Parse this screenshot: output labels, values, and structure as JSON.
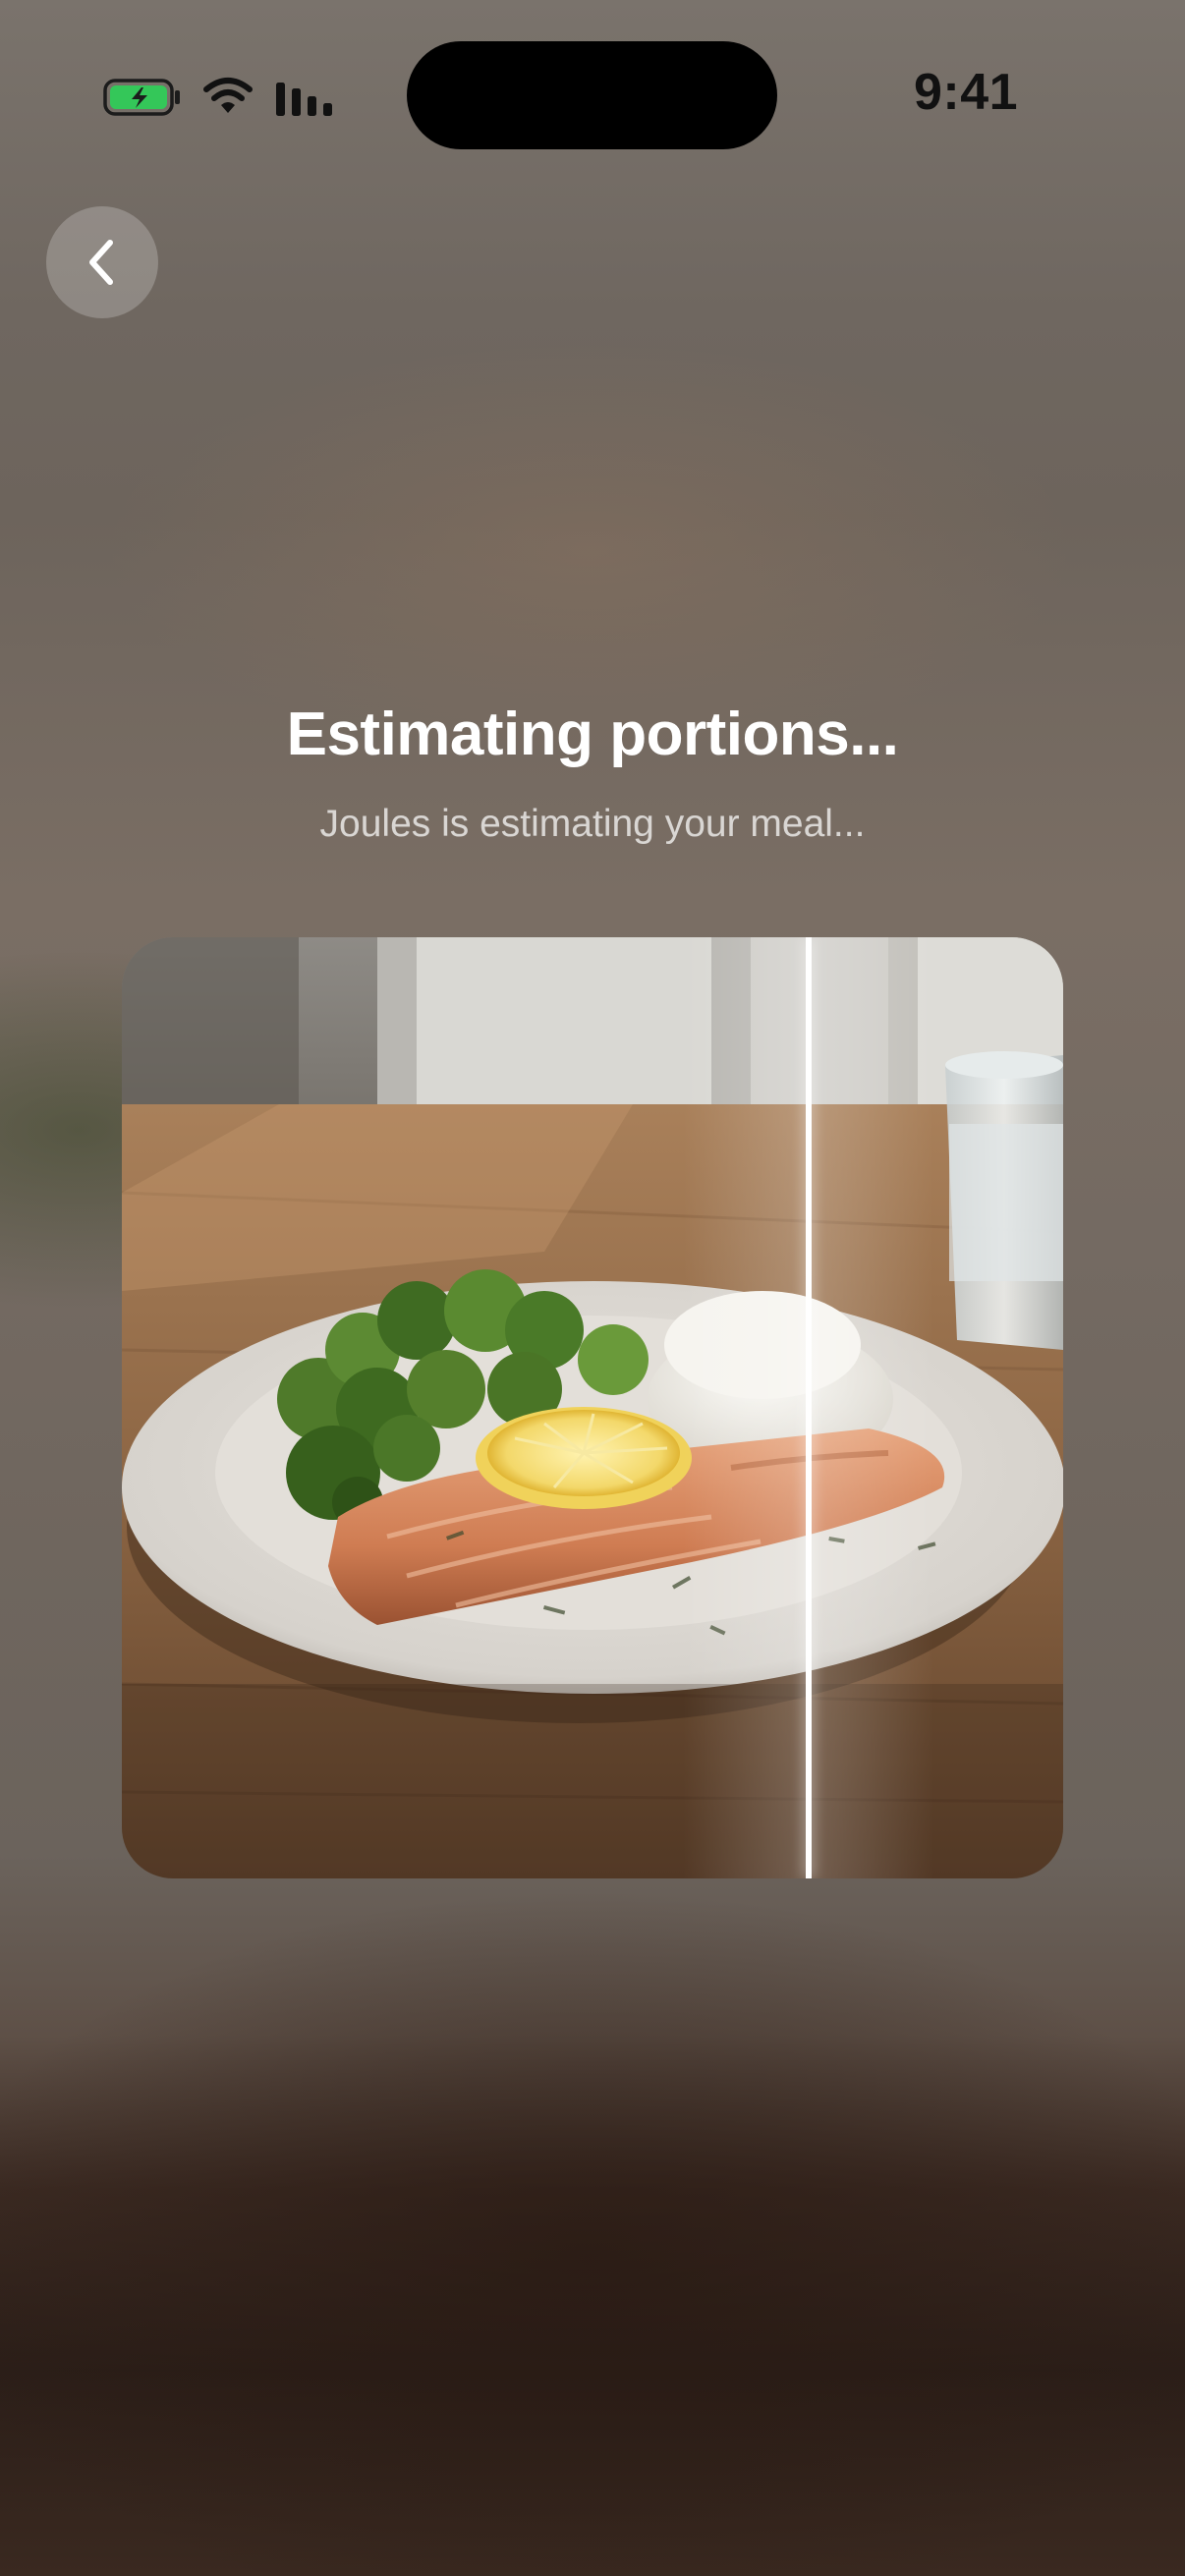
{
  "status_bar": {
    "time": "9:41",
    "battery_icon": "battery-charging-icon",
    "wifi_icon": "wifi-icon",
    "cellular_icon": "cellular-signal-icon"
  },
  "nav": {
    "back_icon": "chevron-left-icon"
  },
  "header": {
    "title": "Estimating portions...",
    "subtitle": "Joules is estimating your meal..."
  },
  "photo": {
    "subject": "salmon-with-broccoli-and-rice",
    "scan_progress": 0.73
  },
  "colors": {
    "battery_fill": "#34c759",
    "title": "#ffffff"
  }
}
